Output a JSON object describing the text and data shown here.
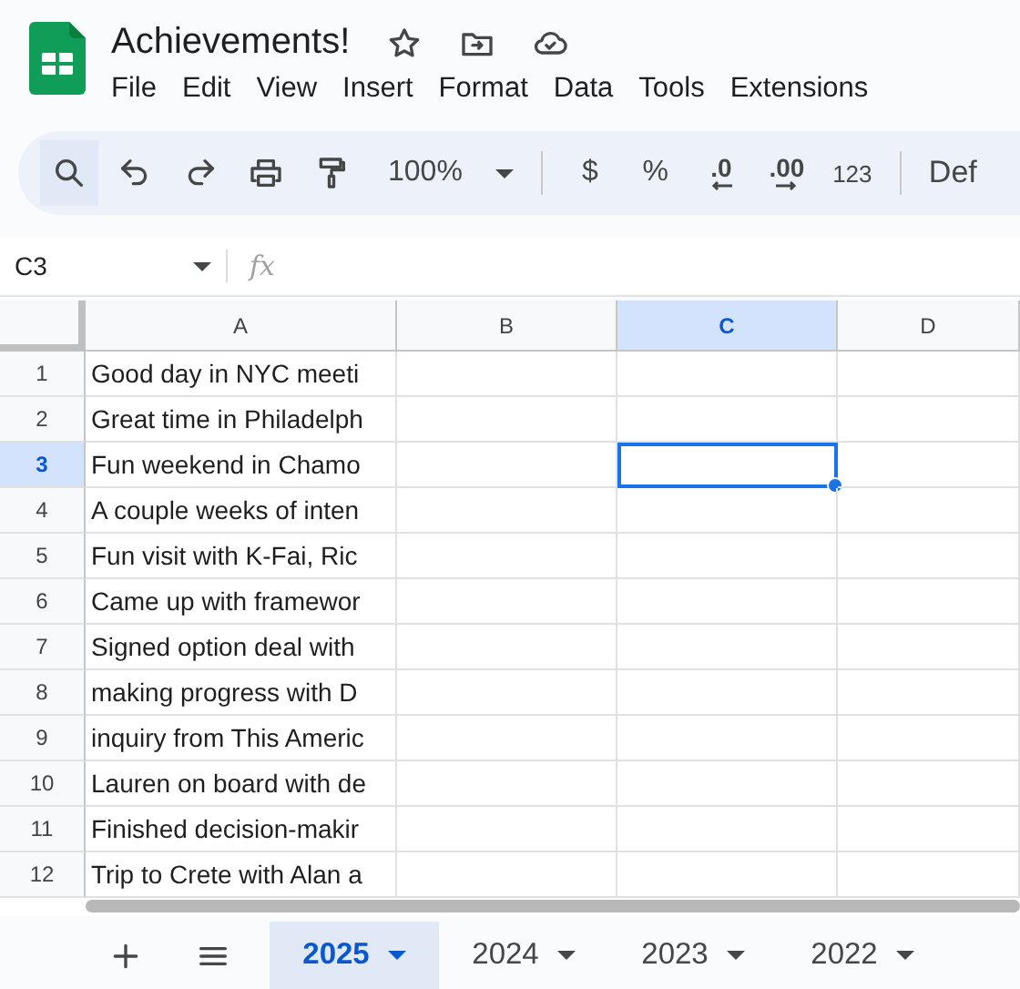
{
  "document": {
    "title": "Achievements!"
  },
  "menu": [
    "File",
    "Edit",
    "View",
    "Insert",
    "Format",
    "Data",
    "Tools",
    "Extensions"
  ],
  "toolbar": {
    "zoom": "100%",
    "currency": "$",
    "percent": "%",
    "decrease_decimals": ".0",
    "increase_decimals": ".00",
    "number_format": "123",
    "font": "Def"
  },
  "formula_bar": {
    "name_box": "C3",
    "function_label": "fx"
  },
  "columns": [
    {
      "label": "A",
      "selected": false
    },
    {
      "label": "B",
      "selected": false
    },
    {
      "label": "C",
      "selected": true
    },
    {
      "label": "D",
      "selected": false
    }
  ],
  "rows": [
    {
      "number": "1",
      "selected": false,
      "cells": [
        "Good day in NYC meeti"
      ]
    },
    {
      "number": "2",
      "selected": false,
      "cells": [
        "Great time in Philadelph"
      ]
    },
    {
      "number": "3",
      "selected": true,
      "cells": [
        "Fun weekend in Chamo"
      ]
    },
    {
      "number": "4",
      "selected": false,
      "cells": [
        "A couple weeks of inten"
      ]
    },
    {
      "number": "5",
      "selected": false,
      "cells": [
        "Fun visit with K-Fai, Ric"
      ]
    },
    {
      "number": "6",
      "selected": false,
      "cells": [
        "Came up with framewor"
      ]
    },
    {
      "number": "7",
      "selected": false,
      "cells": [
        "Signed option deal with"
      ]
    },
    {
      "number": "8",
      "selected": false,
      "cells": [
        "making progress with D"
      ]
    },
    {
      "number": "9",
      "selected": false,
      "cells": [
        "inquiry from This Americ"
      ]
    },
    {
      "number": "10",
      "selected": false,
      "cells": [
        "Lauren on board with de"
      ]
    },
    {
      "number": "11",
      "selected": false,
      "cells": [
        "Finished decision-makir"
      ]
    },
    {
      "number": "12",
      "selected": false,
      "cells": [
        "Trip to Crete with Alan a"
      ]
    }
  ],
  "sheet_tabs": [
    {
      "label": "2025",
      "selected": true
    },
    {
      "label": "2024",
      "selected": false
    },
    {
      "label": "2023",
      "selected": false
    },
    {
      "label": "2022",
      "selected": false
    }
  ]
}
